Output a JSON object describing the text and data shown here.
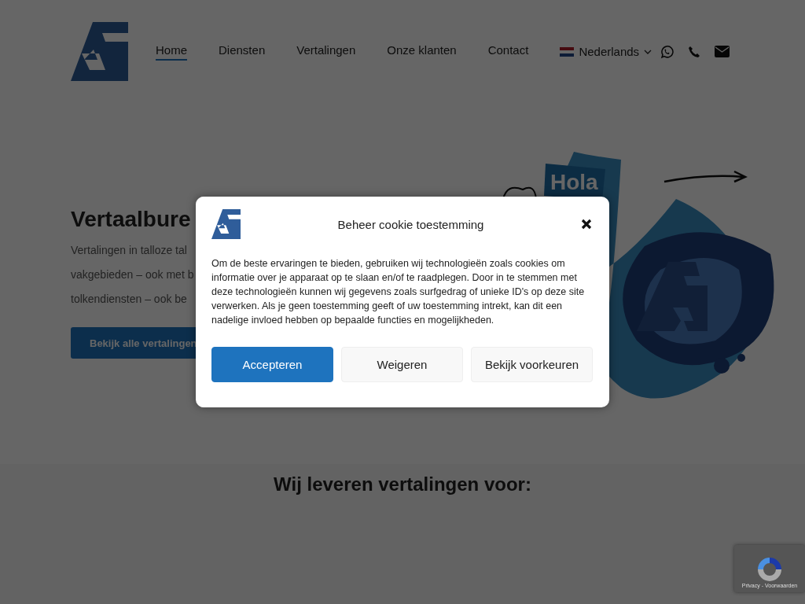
{
  "header": {
    "nav": [
      {
        "label": "Home",
        "selected": true
      },
      {
        "label": "Diensten",
        "selected": false
      },
      {
        "label": "Vertalingen",
        "selected": false
      },
      {
        "label": "Onze klanten",
        "selected": false
      },
      {
        "label": "Contact",
        "selected": false
      }
    ],
    "language": "Nederlands"
  },
  "hero": {
    "title": "Vertaalbure",
    "lines": [
      "Vertalingen in talloze tal",
      "vakgebieden – ook met b",
      "tolkendiensten – ook be"
    ],
    "button": "Bekijk alle vertalingen",
    "illustration_tag": "Hola"
  },
  "section": {
    "heading": "Wij leveren vertalingen voor:"
  },
  "cookie_dialog": {
    "title": "Beheer cookie toestemming",
    "text": "Om de beste ervaringen te bieden, gebruiken wij technologieën zoals cookies om informatie over je apparaat op te slaan en/of te raadplegen. Door in te stemmen met deze technologieën kunnen wij gegevens zoals surfgedrag of unieke ID's op deze site verwerken. Als je geen toestemming geeft of uw toestemming intrekt, kan dit een nadelige invloed hebben op bepaalde functies en mogelijkheden.",
    "buttons": [
      {
        "label": "Accepteren",
        "kind": "primary"
      },
      {
        "label": "Weigeren",
        "kind": "secondary"
      },
      {
        "label": "Bekijk voorkeuren",
        "kind": "secondary"
      }
    ]
  },
  "recaptcha": {
    "text": "Privacy - Voorwaarden"
  }
}
